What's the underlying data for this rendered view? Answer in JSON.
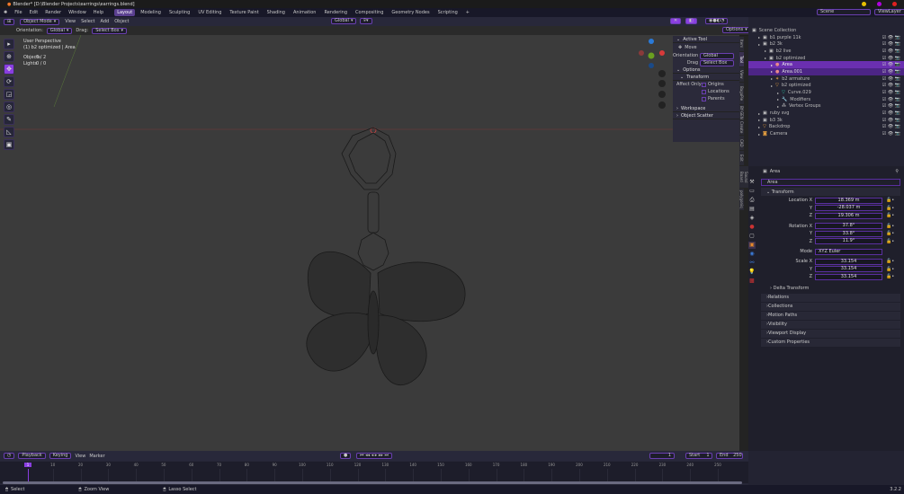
{
  "title": "Blender* [D:\\Blender Projects\\earrings\\earrings.blend]",
  "menu": [
    "File",
    "Edit",
    "Render",
    "Window",
    "Help"
  ],
  "workspaces": [
    "Layout",
    "Modeling",
    "Sculpting",
    "UV Editing",
    "Texture Paint",
    "Shading",
    "Animation",
    "Rendering",
    "Compositing",
    "Geometry Nodes",
    "Scripting",
    "+"
  ],
  "scene": "Scene",
  "view_layer": "ViewLayer",
  "header": {
    "mode": "Object Mode",
    "menus": [
      "View",
      "Select",
      "Add",
      "Object"
    ],
    "transform": "Global",
    "options": "Options"
  },
  "toolsettings": {
    "orientation_label": "Orientation:",
    "orientation": "Global",
    "drag_label": "Drag:",
    "drag": "Select Box"
  },
  "viewport_info": {
    "view": "User Perspective",
    "context": "(1) b2 optimized | Area",
    "objects_label": "Objects",
    "objects": "0 / 2",
    "lights_label": "Lights",
    "lights": "0 / 0"
  },
  "npanel": {
    "active_tool": "Active Tool",
    "move": "Move",
    "orientation_label": "Orientation",
    "orientation": "Global",
    "drag_label": "Drag",
    "drag": "Select Box",
    "options": "Options",
    "transform": "Transform",
    "affect_only": "Affect Only",
    "origins": "Origins",
    "locations": "Locations",
    "parents": "Parents",
    "workspace": "Workspace",
    "object_scatter": "Object Scatter"
  },
  "sidebar_tabs": [
    "Item",
    "Tool",
    "View",
    "BagaPie",
    "BY-GEN",
    "Create",
    "CAD",
    "Edit",
    "Sound Board",
    "polygoniq"
  ],
  "outliner": [
    {
      "label": "Scene Collection",
      "depth": 0,
      "icon": "collection-icon"
    },
    {
      "label": "b1 purple 11k",
      "depth": 1,
      "icon": "collection-icon"
    },
    {
      "label": "b2 3k",
      "depth": 1,
      "icon": "collection-icon"
    },
    {
      "label": "b2 live",
      "depth": 2,
      "icon": "collection-icon"
    },
    {
      "label": "b2 optimized",
      "depth": 2,
      "icon": "collection-icon"
    },
    {
      "label": "Area",
      "depth": 3,
      "icon": "light-icon",
      "state": "sel"
    },
    {
      "label": "Area.001",
      "depth": 3,
      "icon": "light-icon",
      "state": "sel2"
    },
    {
      "label": "b2 armature",
      "depth": 3,
      "icon": "armature-icon"
    },
    {
      "label": "b2 optimized",
      "depth": 3,
      "icon": "mesh-icon"
    },
    {
      "label": "Curve.029",
      "depth": 4,
      "icon": "curve-icon"
    },
    {
      "label": "Modifiers",
      "depth": 4,
      "icon": "wrench-icon"
    },
    {
      "label": "Vertex Groups",
      "depth": 4,
      "icon": "vertex-groups-icon"
    },
    {
      "label": "ruby svg",
      "depth": 1,
      "icon": "collection-icon"
    },
    {
      "label": "b3 3k",
      "depth": 1,
      "icon": "collection-icon"
    },
    {
      "label": "Backdrop",
      "depth": 1,
      "icon": "mesh-icon"
    },
    {
      "label": "Camera",
      "depth": 1,
      "icon": "camera-icon"
    }
  ],
  "properties": {
    "object_name": "Area",
    "data_name": "Area",
    "transform": "Transform",
    "location": [
      {
        "label": "Location X",
        "value": "18.369 m"
      },
      {
        "label": "Y",
        "value": "-28.037 m"
      },
      {
        "label": "Z",
        "value": "19.306 m"
      }
    ],
    "rotation": [
      {
        "label": "Rotation X",
        "value": "37.8°"
      },
      {
        "label": "Y",
        "value": "33.8°"
      },
      {
        "label": "Z",
        "value": "11.9°"
      }
    ],
    "mode_label": "Mode",
    "mode": "XYZ Euler",
    "scale": [
      {
        "label": "Scale X",
        "value": "33.154"
      },
      {
        "label": "Y",
        "value": "33.154"
      },
      {
        "label": "Z",
        "value": "33.154"
      }
    ],
    "delta": "Delta Transform",
    "sections": [
      "Relations",
      "Collections",
      "Motion Paths",
      "Visibility",
      "Viewport Display",
      "Custom Properties"
    ]
  },
  "timeline": {
    "menus": [
      "Playback",
      "Keying",
      "View",
      "Marker"
    ],
    "current": "1",
    "start_label": "Start",
    "start": "1",
    "end_label": "End",
    "end": "250",
    "ticks": [
      "1",
      "10",
      "20",
      "30",
      "40",
      "50",
      "60",
      "70",
      "80",
      "90",
      "100",
      "110",
      "120",
      "130",
      "140",
      "150",
      "160",
      "170",
      "180",
      "190",
      "200",
      "210",
      "220",
      "230",
      "240",
      "250"
    ]
  },
  "status": {
    "items": [
      "Select",
      "Zoom View",
      "Lasso Select"
    ],
    "version": "3.2.2"
  },
  "colors": {
    "accent": "#8a3ee0",
    "selection": "#6a2fb0"
  }
}
